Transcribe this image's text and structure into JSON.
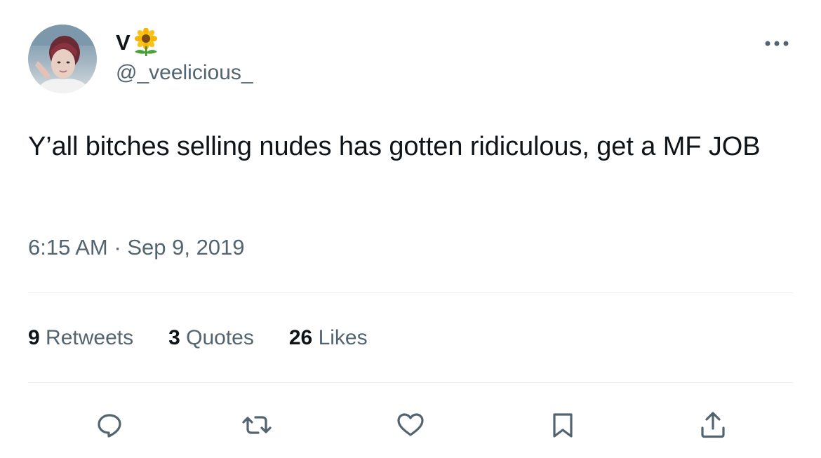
{
  "author": {
    "display_name": "V",
    "name_emoji": "sunflower-icon",
    "handle": "@_veelicious_"
  },
  "tweet": {
    "text": "Y’all bitches selling nudes has gotten ridiculous, get a MF JOB",
    "time": "6:15 AM",
    "separator": "·",
    "date": "Sep 9, 2019"
  },
  "stats": {
    "retweets_count": "9",
    "retweets_label": "Retweets",
    "quotes_count": "3",
    "quotes_label": "Quotes",
    "likes_count": "26",
    "likes_label": "Likes"
  },
  "actions": [
    "reply-icon",
    "retweet-icon",
    "like-icon",
    "bookmark-icon",
    "share-icon"
  ],
  "colors": {
    "text": "#0f1419",
    "secondary": "#536471",
    "divider": "#e6ecf0",
    "background": "#ffffff"
  }
}
